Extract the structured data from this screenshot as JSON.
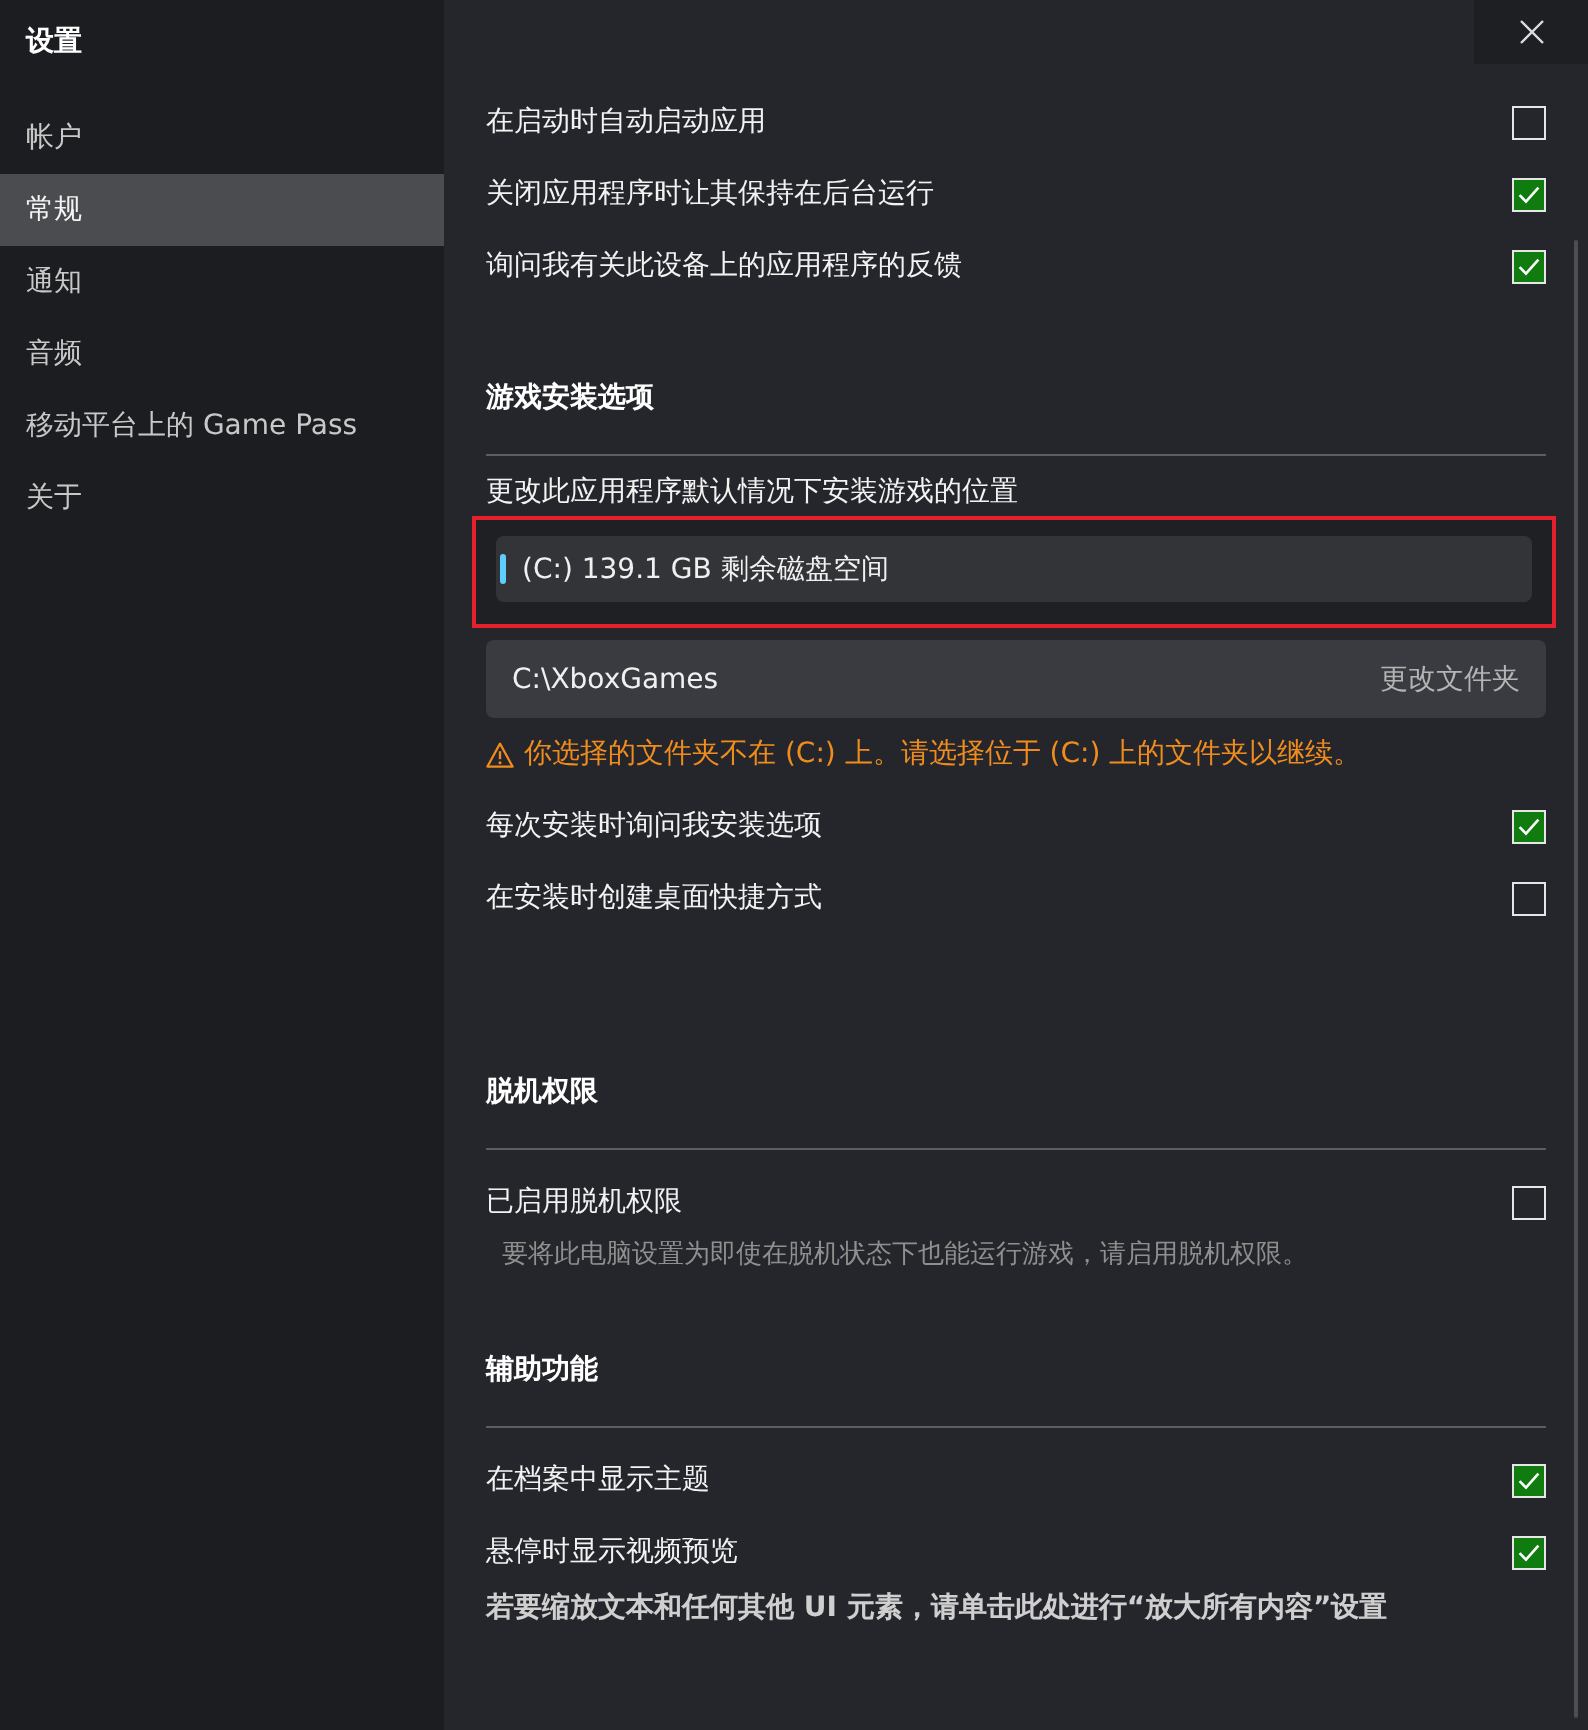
{
  "window": {
    "title": "设置"
  },
  "sidebar": {
    "items": [
      {
        "label": "帐户",
        "selected": false
      },
      {
        "label": "常规",
        "selected": true
      },
      {
        "label": "通知",
        "selected": false
      },
      {
        "label": "音频",
        "selected": false
      },
      {
        "label": "移动平台上的 Game Pass",
        "selected": false
      },
      {
        "label": "关于",
        "selected": false
      }
    ]
  },
  "sections": [
    {
      "items": [
        {
          "kind": "checkbox",
          "label": "在启动时自动启动应用",
          "checked": false
        },
        {
          "kind": "checkbox",
          "label": "关闭应用程序时让其保持在后台运行",
          "checked": true
        },
        {
          "kind": "checkbox",
          "label": "询问我有关此设备上的应用程序的反馈",
          "checked": true
        }
      ]
    },
    {
      "heading": "游戏安装选项",
      "items": [
        {
          "kind": "caption",
          "text": "更改此应用程序默认情况下安装游戏的位置"
        },
        {
          "kind": "drive_select",
          "value": "(C:) 139.1 GB 剩余磁盘空间",
          "highlighted": true
        },
        {
          "kind": "folder",
          "path": "C:\\XboxGames",
          "action": "更改文件夹"
        },
        {
          "kind": "warning",
          "text": "你选择的文件夹不在 (C:) 上。请选择位于 (C:) 上的文件夹以继续。"
        },
        {
          "kind": "checkbox",
          "label": "每次安装时询问我安装选项",
          "checked": true
        },
        {
          "kind": "checkbox",
          "label": "在安装时创建桌面快捷方式",
          "checked": false
        }
      ]
    },
    {
      "heading": "脱机权限",
      "items": [
        {
          "kind": "checkbox",
          "label": "已启用脱机权限",
          "checked": false
        },
        {
          "kind": "note",
          "text": "要将此电脑设置为即使在脱机状态下也能运行游戏，请启用脱机权限。"
        }
      ]
    },
    {
      "heading": "辅助功能",
      "items": [
        {
          "kind": "checkbox",
          "label": "在档案中显示主题",
          "checked": true
        },
        {
          "kind": "checkbox",
          "label": "悬停时显示视频预览",
          "checked": true
        },
        {
          "kind": "link",
          "text": "若要缩放文本和任何其他 UI 元素，请单击此处进行“放大所有内容”设置"
        }
      ]
    }
  ]
}
